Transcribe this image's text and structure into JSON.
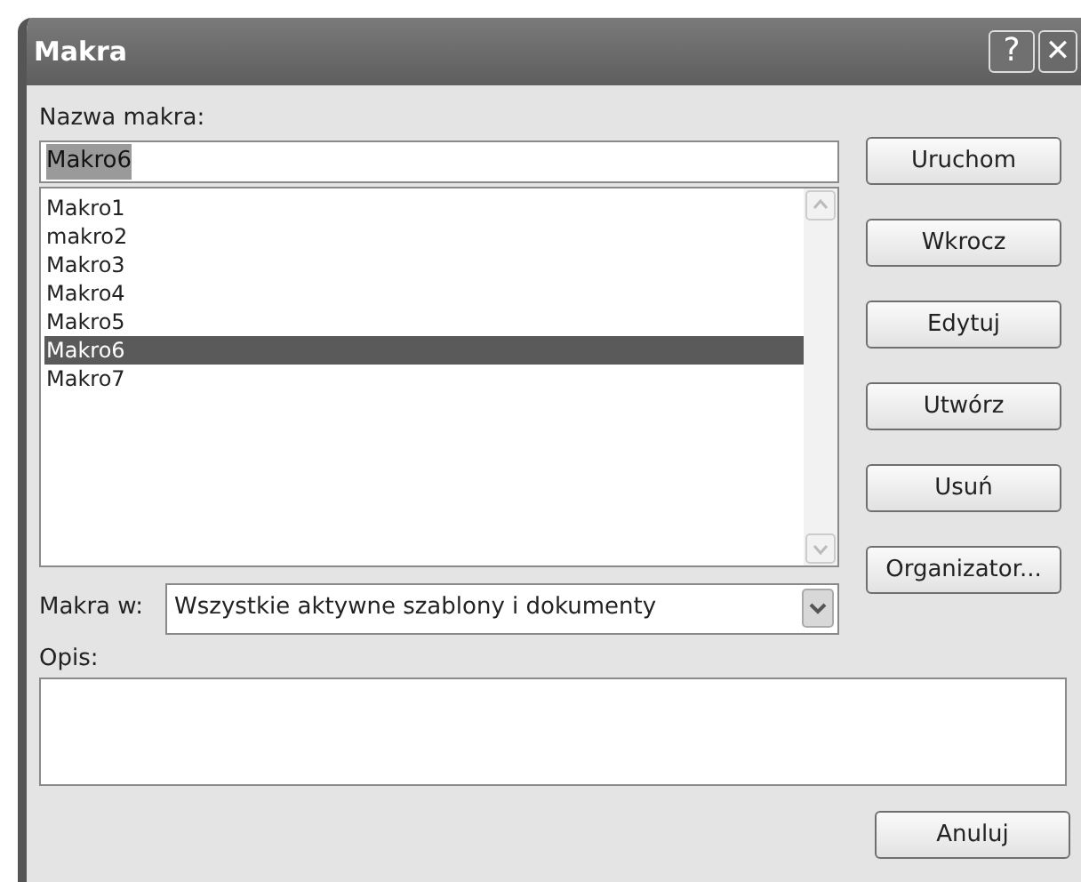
{
  "window": {
    "title": "Makra"
  },
  "title_buttons": [
    {
      "kind": "help",
      "label": "?"
    },
    {
      "kind": "close",
      "label": "✕"
    }
  ],
  "name_field": {
    "label": "Nazwa makra:",
    "value": "Makro6"
  },
  "macros": [
    {
      "name": "Makro1",
      "selected": false
    },
    {
      "name": "makro2",
      "selected": false
    },
    {
      "name": "Makro3",
      "selected": false
    },
    {
      "name": "Makro4",
      "selected": false
    },
    {
      "name": "Makro5",
      "selected": false
    },
    {
      "name": "Makro6",
      "selected": true
    },
    {
      "name": "Makro7",
      "selected": false
    }
  ],
  "macros_in": {
    "label": "Makra w:",
    "value": "Wszystkie aktywne szablony i dokumenty"
  },
  "description": {
    "label": "Opis:"
  },
  "buttons": [
    {
      "label": "Uruchom"
    },
    {
      "label": "Wkrocz"
    },
    {
      "label": "Edytuj"
    },
    {
      "label": "Utwórz"
    },
    {
      "label": "Usuń"
    },
    {
      "label": "Organizator..."
    }
  ],
  "cancel_button": {
    "label": "Anuluj"
  }
}
